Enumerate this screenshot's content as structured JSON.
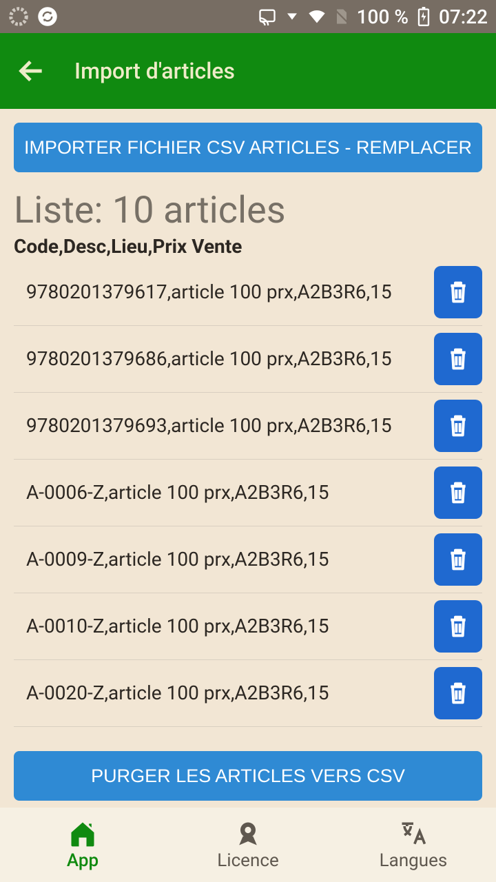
{
  "status": {
    "battery": "100 %",
    "time": "07:22"
  },
  "appbar": {
    "title": "Import d'articles"
  },
  "buttons": {
    "import_csv": "IMPORTER FICHIER CSV ARTICLES - REMPLACER",
    "purge_csv": "PURGER LES ARTICLES VERS CSV"
  },
  "list": {
    "title": "Liste: 10 articles",
    "header": "Code,Desc,Lieu,Prix Vente",
    "items": [
      {
        "text": "9780201379617,article 100 prx,A2B3R6,15"
      },
      {
        "text": "9780201379686,article 100 prx,A2B3R6,15"
      },
      {
        "text": "9780201379693,article 100 prx,A2B3R6,15"
      },
      {
        "text": "A-0006-Z,article 100 prx,A2B3R6,15"
      },
      {
        "text": "A-0009-Z,article 100 prx,A2B3R6,15"
      },
      {
        "text": "A-0010-Z,article 100 prx,A2B3R6,15"
      },
      {
        "text": "A-0020-Z,article 100 prx,A2B3R6,15"
      }
    ]
  },
  "nav": {
    "app": "App",
    "licence": "Licence",
    "langues": "Langues"
  }
}
